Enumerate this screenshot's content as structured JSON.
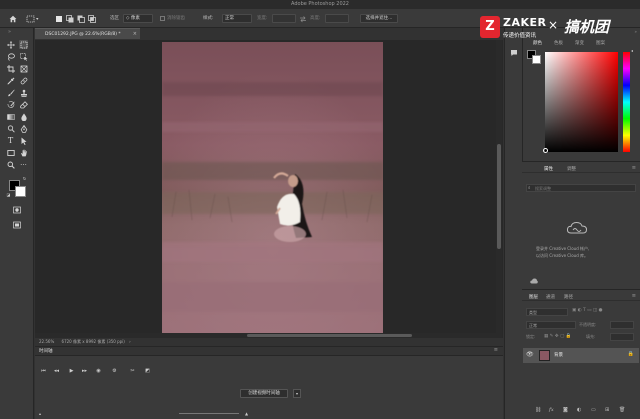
{
  "app": {
    "window_title": "Adobe Photoshop 2022"
  },
  "options_bar": {
    "home_icon": "home-icon",
    "mode_label": "选区",
    "mode_value": "◇ 像素",
    "antialias_label": "消除锯齿",
    "style_label": "样式:",
    "style_value": "正常",
    "width_label": "宽度:",
    "height_label": "高度:",
    "select_mask_button": "选择并遮住..."
  },
  "document": {
    "tab_title": "DSC01292.JPG @ 22.6%(RGB/8) *",
    "status_zoom": "22.56%",
    "status_info": "6720 像素 x 8992 像素 (350 ppi)"
  },
  "timeline": {
    "title": "时间轴",
    "create_button": "创建视频时间轴"
  },
  "right_strip": {
    "labels": [
      "颜色",
      "色板",
      "渐变",
      "图案"
    ]
  },
  "color_panel": {
    "tabs": [
      "颜色",
      "色板",
      "渐变",
      "图案"
    ],
    "foreground": "#000000",
    "background": "#ffffff",
    "field_hue": "#ff0000"
  },
  "properties_panel": {
    "tabs": [
      "属性",
      "调整"
    ],
    "search_placeholder": "搜索调整",
    "cloud_message_line1": "登录并 Creative Cloud 帐户,",
    "cloud_message_line2": "以访问 Creative Cloud 库。"
  },
  "layers_panel": {
    "tabs": [
      "图层",
      "通道",
      "路径"
    ],
    "kind_placeholder": "类型",
    "blend_mode": "正常",
    "opacity_label": "不透明度:",
    "lock_label": "锁定:",
    "fill_label": "填充:",
    "layers": [
      {
        "name": "背景",
        "visible": true,
        "locked": true
      }
    ]
  },
  "watermark": {
    "brand_left": "ZAKER",
    "brand_left_sub": "传递价值资讯",
    "separator": "×",
    "brand_right": "搞机团"
  },
  "colors": {
    "accent_red": "#e3262f",
    "panel_bg": "#3a3a3a",
    "canvas_bg": "#282828",
    "photo_mauve": "#8a5862"
  }
}
